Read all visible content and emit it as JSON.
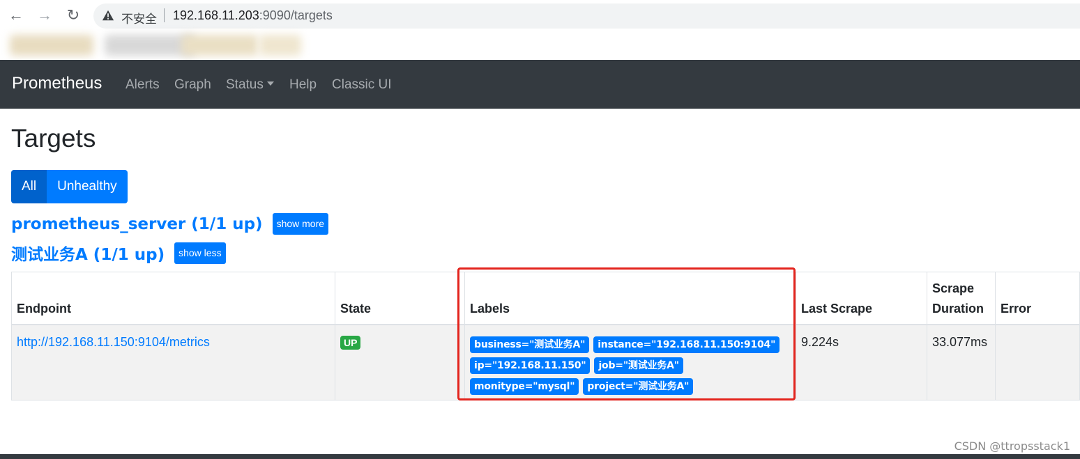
{
  "browser": {
    "insecure_label": "不安全",
    "url_host": "192.168.11.203",
    "url_rest": ":9090/targets"
  },
  "navbar": {
    "brand": "Prometheus",
    "links": [
      "Alerts",
      "Graph",
      "Status",
      "Help",
      "Classic UI"
    ]
  },
  "page": {
    "title": "Targets",
    "filters": {
      "all": "All",
      "unhealthy": "Unhealthy"
    }
  },
  "jobs": [
    {
      "title": "prometheus_server (1/1 up)",
      "toggle": "show more"
    },
    {
      "title": "测试业务A (1/1 up)",
      "toggle": "show less"
    }
  ],
  "table": {
    "headers": {
      "endpoint": "Endpoint",
      "state": "State",
      "labels": "Labels",
      "last_scrape": "Last Scrape",
      "scrape_duration_1": "Scrape",
      "scrape_duration_2": "Duration",
      "error": "Error"
    },
    "row": {
      "endpoint": "http://192.168.11.150:9104/metrics",
      "state": "UP",
      "labels": [
        "business=\"测试业务A\"",
        "instance=\"192.168.11.150:9104\"",
        "ip=\"192.168.11.150\"",
        "job=\"测试业务A\"",
        "monitype=\"mysql\"",
        "project=\"测试业务A\""
      ],
      "last_scrape": "9.224s",
      "scrape_duration": "33.077ms",
      "error": ""
    }
  },
  "watermark": "CSDN @ttropsstack1",
  "colors": {
    "navbar_bg": "#343a40",
    "primary": "#007bff",
    "success": "#28a745",
    "highlight": "#e3241d"
  }
}
